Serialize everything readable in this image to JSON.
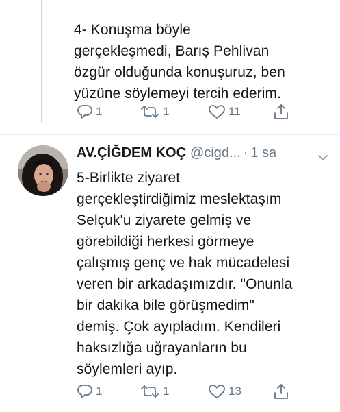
{
  "tweet1": {
    "lines": [
      "4- Konuşma böyle",
      "gerçekleşmedi, Barış Pehlivan",
      "özgür olduğunda konuşuruz, ben",
      "yüzüne söylemeyi tercih ederim."
    ],
    "reply_count": "1",
    "retweet_count": "1",
    "like_count": "11"
  },
  "tweet2": {
    "name": "AV.ÇİĞDEM KOÇ",
    "handle": "@cigd...",
    "dot": "·",
    "time": "1 sa",
    "lines": [
      "5-Birlikte ziyaret",
      "gerçekleştirdiğimiz meslektaşım",
      "Selçuk'u ziyarete gelmiş ve",
      "görebildiği herkesi görmeye",
      "çalışmış genç ve hak mücadelesi",
      "veren bir arkadaşımızdır. \"Onunla",
      "bir dakika bile görüşmedim\"",
      "demiş. Çok ayıpladım. Kendileri",
      "haksızlığa uğrayanların bu",
      "söylemleri ayıp."
    ],
    "reply_count": "1",
    "retweet_count": "1",
    "like_count": "13"
  },
  "colors": {
    "text": "#14171a",
    "secondary": "#657786",
    "divider": "#e6ecf0",
    "thread_line": "#ccd6dd"
  },
  "icons": [
    "reply-icon",
    "retweet-icon",
    "like-icon",
    "share-icon",
    "chevron-down-icon"
  ]
}
